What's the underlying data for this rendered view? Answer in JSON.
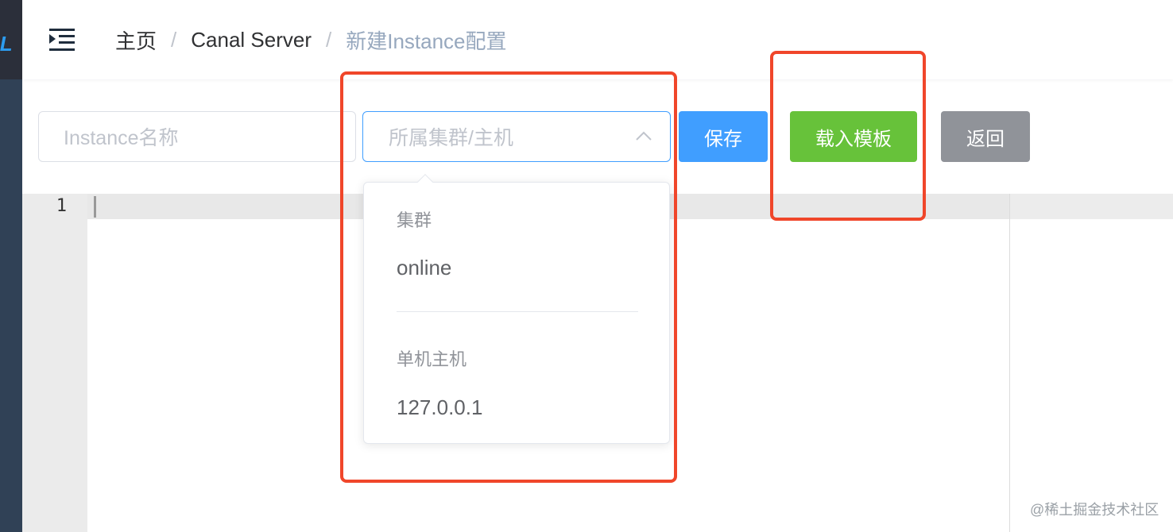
{
  "sidebar": {
    "logo_text": "AL"
  },
  "breadcrumb": {
    "items": [
      "主页",
      "Canal Server",
      "新建Instance配置"
    ],
    "separator": "/"
  },
  "form": {
    "instance_name_placeholder": "Instance名称",
    "cluster_select_placeholder": "所属集群/主机"
  },
  "buttons": {
    "save": "保存",
    "load_template": "载入模板",
    "back": "返回"
  },
  "dropdown": {
    "groups": [
      {
        "label": "集群",
        "options": [
          "online"
        ]
      },
      {
        "label": "单机主机",
        "options": [
          "127.0.0.1"
        ]
      }
    ]
  },
  "editor": {
    "line_number": "1"
  },
  "watermark": "@稀土掘金技术社区",
  "colors": {
    "primary": "#409eff",
    "success": "#67c23a",
    "info": "#909399",
    "annotation": "#f0462a",
    "sidebar": "#304156"
  }
}
